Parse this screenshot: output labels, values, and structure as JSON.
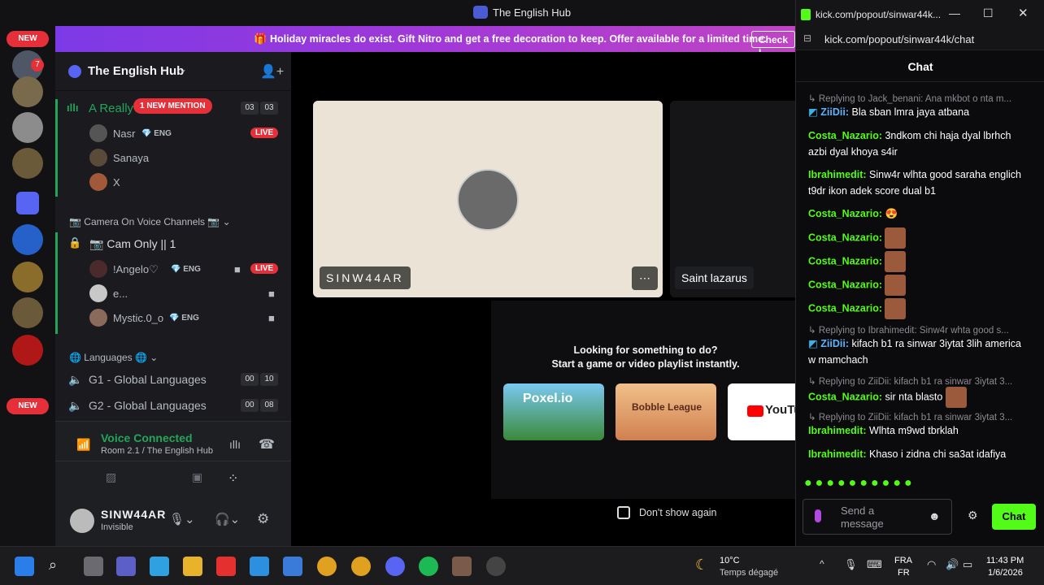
{
  "window": {
    "title": "The English Hub"
  },
  "guilds": {
    "new_badge_top": "NEW",
    "new_badge_bottom": "NEW",
    "unread_count": "7"
  },
  "banner": {
    "message": "Holiday miracles do exist. Gift Nitro and get a free decoration to keep. Offer available for a limited time.",
    "cta": "Check i"
  },
  "server": {
    "name": "The English Hub"
  },
  "channels": {
    "ch1": {
      "name": "A Really",
      "mention": "1 NEW MENTION",
      "count_a": "03",
      "count_b": "03"
    },
    "ch1_users": [
      {
        "name": "Nasr",
        "tag": "ENG",
        "live": "LIVE"
      },
      {
        "name": "Sanaya"
      },
      {
        "name": "X"
      }
    ],
    "category_camera": "Camera On Voice Channels",
    "cam": {
      "name": "Cam Only || 1"
    },
    "cam_users": [
      {
        "name": "!Angelo♡",
        "tag": "ENG",
        "live": "LIVE"
      },
      {
        "name": "e..."
      },
      {
        "name": "Mystic.0_o",
        "tag": "ENG"
      }
    ],
    "category_lang": "Languages",
    "g1": {
      "name": "G1 - Global Languages",
      "count_a": "00",
      "count_b": "10"
    },
    "g2": {
      "name": "G2 - Global Languages",
      "count_a": "00",
      "count_b": "08"
    }
  },
  "voice": {
    "status": "Voice Connected",
    "room": "Room 2.1 / The English Hub"
  },
  "user": {
    "name": "SINW44AR",
    "status": "Invisible"
  },
  "stage": {
    "tile1_name": "SINW44AR",
    "tile2_name": "Saint lazarus",
    "activity_title": "Looking for something to do?",
    "activity_sub": "Start a game or video playlist instantly.",
    "cards": [
      "Poxel.io",
      "Bobble League",
      "YouTu"
    ],
    "dont_show": "Don't show again"
  },
  "chat": {
    "tab_url": "kick.com/popout/sinwar44k...",
    "url": "kick.com/popout/sinwar44k/chat",
    "header": "Chat",
    "input_placeholder": "Send a message",
    "send_label": "Chat",
    "messages": [
      {
        "reply": "Replying to Jack_benani: Ana mkbot o nta m..."
      },
      {
        "user": "ZiiDii:",
        "text": "Bla sban lmra jaya atbana"
      },
      {
        "user": "Costa_Nazario:",
        "text": "3ndkom chi haja dyal lbrhch azbi dyal khoya s4ir"
      },
      {
        "user": "Ibrahimedit:",
        "text": "Sinw4r wlhta good saraha englich t9dr ikon adek score dual b1"
      },
      {
        "user": "Costa_Nazario:",
        "text": "😍"
      },
      {
        "user": "Costa_Nazario:"
      },
      {
        "user": "Costa_Nazario:"
      },
      {
        "user": "Costa_Nazario:"
      },
      {
        "user": "Costa_Nazario:"
      },
      {
        "reply": "Replying to Ibrahimedit: Sinw4r whta good s..."
      },
      {
        "user": "ZiiDii:",
        "text": "kifach b1 ra sinwar 3iytat 3lih america w mamchach"
      },
      {
        "reply": "Replying to ZiiDii: kifach b1 ra sinwar 3iytat 3..."
      },
      {
        "user": "Costa_Nazario:",
        "text": "sir nta blasto"
      },
      {
        "reply": "Replying to ZiiDii: kifach b1 ra sinwar 3iytat 3..."
      },
      {
        "user": "Ibrahimedit:",
        "text": "Wlhta m9wd tbrklah"
      },
      {
        "user": "Ibrahimedit:",
        "text": "Khaso i zidna chi sa3at idafiya"
      }
    ]
  },
  "taskbar": {
    "temp": "10°C",
    "weather": "Temps dégagé",
    "lang1": "FRA",
    "lang2": "FR",
    "time": "11:43 PM",
    "date": "1/6/2026"
  },
  "colors": {
    "kick_green": "#53fc18",
    "discord_live": "#e5303a",
    "nitro_purple": "#7c3ae6"
  }
}
